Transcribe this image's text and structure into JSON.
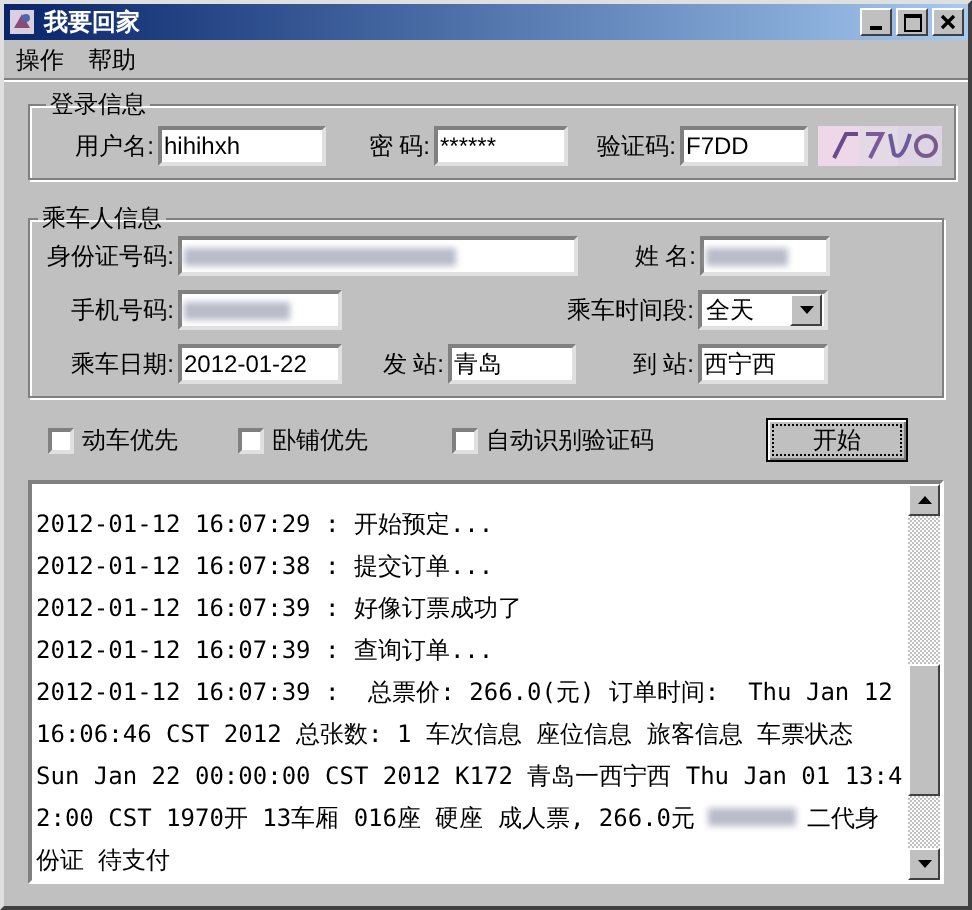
{
  "window": {
    "title": "我要回家"
  },
  "menu": [
    {
      "label": "操作"
    },
    {
      "label": "帮助"
    }
  ],
  "login": {
    "title": "登录信息",
    "fields": [
      {
        "kind": "text",
        "label": "用户名:",
        "value": "hihihxh"
      },
      {
        "kind": "text",
        "label": "密 码:",
        "value": "******"
      },
      {
        "kind": "text",
        "label": "验证码:",
        "value": "F7DD"
      }
    ]
  },
  "passenger": {
    "title": "乘车人信息",
    "rows": [
      [
        {
          "kind": "redacted",
          "label": "身份证号码:"
        },
        {
          "kind": "redacted",
          "label": "姓 名:"
        }
      ],
      [
        {
          "kind": "redacted",
          "label": "手机号码:"
        },
        {
          "kind": "select",
          "label": "乘车时间段:",
          "value": "全天"
        }
      ],
      [
        {
          "kind": "text",
          "label": "乘车日期:",
          "value": "2012-01-22"
        },
        {
          "kind": "text",
          "label": "发 站:",
          "value": "青岛"
        },
        {
          "kind": "text",
          "label": "到 站:",
          "value": "西宁西"
        }
      ]
    ]
  },
  "options": [
    {
      "label": "动车优先",
      "checked": false
    },
    {
      "label": "卧铺优先",
      "checked": false
    },
    {
      "label": "自动识别验证码",
      "checked": false
    }
  ],
  "start_button": "开始",
  "log": {
    "lines": [
      [
        {
          "kind": "text",
          "text": "2012-01-12 16:07:29 : 开始预定..."
        }
      ],
      [
        {
          "kind": "text",
          "text": "2012-01-12 16:07:38 : 提交订单..."
        }
      ],
      [
        {
          "kind": "text",
          "text": "2012-01-12 16:07:39 : 好像订票成功了"
        }
      ],
      [
        {
          "kind": "text",
          "text": "2012-01-12 16:07:39 : 查询订单..."
        }
      ],
      [
        {
          "kind": "text",
          "text": "2012-01-12 16:07:39 :  总票价: 266.0(元) 订单时间:  Thu Jan 12"
        }
      ],
      [
        {
          "kind": "text",
          "text": "16:06:46 CST 2012 总张数: 1 车次信息 座位信息 旅客信息 车票状态"
        }
      ],
      [
        {
          "kind": "text",
          "text": "Sun Jan 22 00:00:00 CST 2012 K172 青岛一西宁西 Thu Jan 01 13:4"
        }
      ],
      [
        {
          "kind": "text",
          "text": "2:00 CST 1970开 13车厢 016座 硬座 成人票, 266.0元"
        },
        {
          "kind": "redacted"
        },
        {
          "kind": "text",
          "text": "二代身"
        }
      ],
      [
        {
          "kind": "text",
          "text": "份证 待支付"
        }
      ]
    ]
  }
}
